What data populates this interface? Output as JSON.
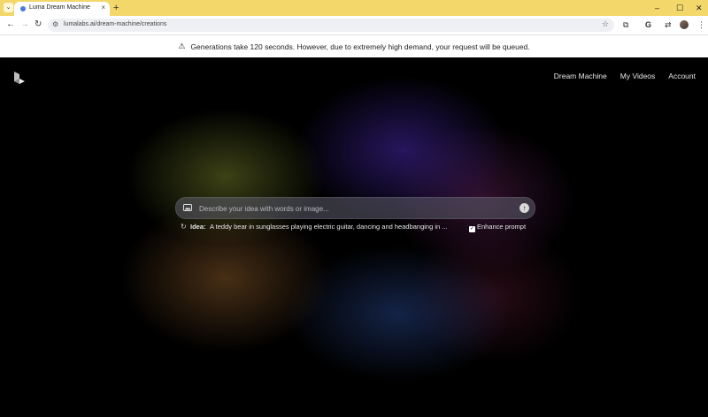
{
  "browser": {
    "tab_title": "Luma Dream Machine",
    "tab_close": "×",
    "new_tab": "+",
    "tab_menu": "⌄",
    "url": "lumalabs.ai/dream-machine/creations",
    "window_controls": {
      "minimize": "–",
      "maximize": "☐",
      "close": "✕"
    },
    "nav": {
      "back": "←",
      "forward": "→",
      "reload": "↻"
    },
    "toolbar_icons": {
      "extensions": "⧉",
      "google": "G",
      "translate": "⇄",
      "menu": "⋮",
      "star": "☆"
    }
  },
  "notice": {
    "icon": "warning-icon",
    "text": "Generations take 120 seconds. However, due to extremely high demand, your request will be queued."
  },
  "header": {
    "nav": [
      "Dream Machine",
      "My Videos",
      "Account"
    ]
  },
  "prompt": {
    "placeholder": "Describe your idea with words or image...",
    "submit_icon": "↑"
  },
  "idea": {
    "label": "Idea:",
    "text": "A teddy bear in sunglasses playing electric guitar, dancing and headbanging in ...",
    "enhance_label": "Enhance prompt",
    "enhance_checked": true
  },
  "colors": {
    "chrome_tab_strip": "#f4d76a",
    "page_background": "#000000"
  }
}
